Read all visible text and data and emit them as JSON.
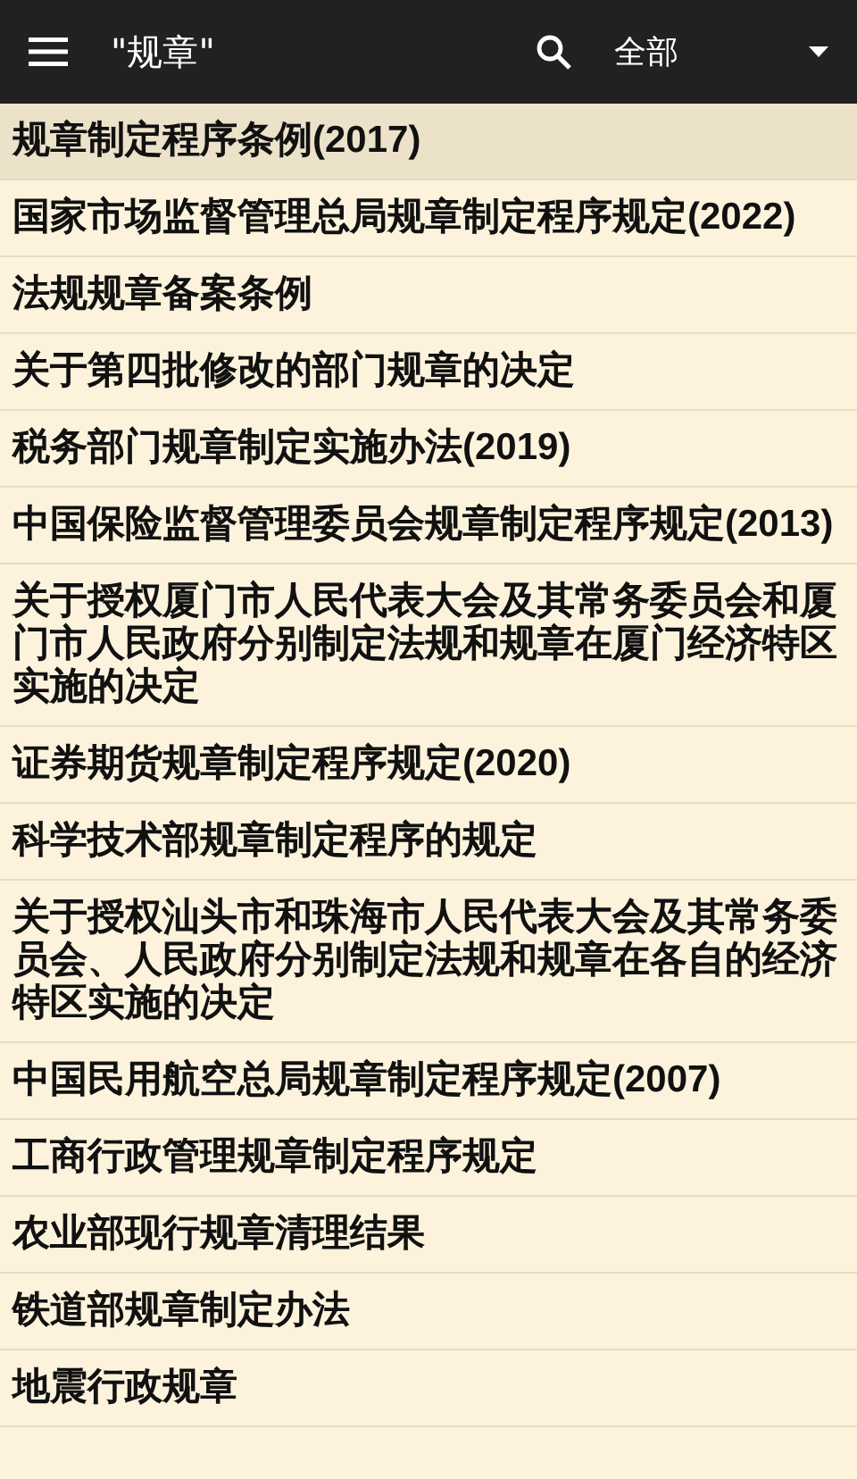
{
  "toolbar": {
    "title": "\"规章\"",
    "filter": "全部"
  },
  "results": [
    {
      "text": "规章制定程序条例(2017)",
      "selected": true
    },
    {
      "text": "国家市场监督管理总局规章制定程序规定(2022)",
      "selected": false
    },
    {
      "text": "法规规章备案条例",
      "selected": false
    },
    {
      "text": "关于第四批修改的部门规章的决定",
      "selected": false
    },
    {
      "text": "税务部门规章制定实施办法(2019)",
      "selected": false
    },
    {
      "text": "中国保险监督管理委员会规章制定程序规定(2013)",
      "selected": false
    },
    {
      "text": "关于授权厦门市人民代表大会及其常务委员会和厦门市人民政府分别制定法规和规章在厦门经济特区实施的决定",
      "selected": false
    },
    {
      "text": "证券期货规章制定程序规定(2020)",
      "selected": false
    },
    {
      "text": "科学技术部规章制定程序的规定",
      "selected": false
    },
    {
      "text": "关于授权汕头市和珠海市人民代表大会及其常务委员会、人民政府分别制定法规和规章在各自的经济特区实施的决定",
      "selected": false
    },
    {
      "text": "中国民用航空总局规章制定程序规定(2007)",
      "selected": false
    },
    {
      "text": "工商行政管理规章制定程序规定",
      "selected": false
    },
    {
      "text": "农业部现行规章清理结果",
      "selected": false
    },
    {
      "text": "铁道部规章制定办法",
      "selected": false
    },
    {
      "text": "地震行政规章",
      "selected": false
    }
  ]
}
